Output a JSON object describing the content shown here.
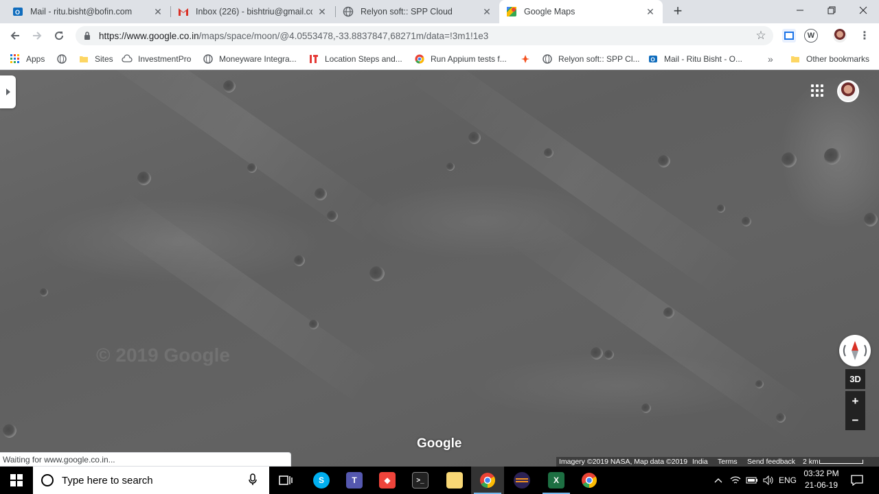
{
  "tabs": [
    {
      "title": "Mail - ritu.bisht@bofin.com",
      "icon": "outlook-icon"
    },
    {
      "title": "Inbox (226) - bishtriu@gmail.com",
      "icon": "gmail-icon"
    },
    {
      "title": "Relyon soft:: SPP Cloud",
      "icon": "globe-icon"
    },
    {
      "title": "Google Maps",
      "icon": "google-maps-icon",
      "active": true
    }
  ],
  "address_bar": {
    "host": "https://www.google.co.in",
    "path": "/maps/space/moon/@4.0553478,-33.8837847,68271m/data=!3m1!1e3"
  },
  "bookmarks": [
    {
      "label": "Apps",
      "icon": "apps-grid-icon"
    },
    {
      "label": "",
      "icon": "globe-icon"
    },
    {
      "label": "Sites",
      "icon": "folder-icon"
    },
    {
      "label": "InvestmentPro",
      "icon": "cloud-icon"
    },
    {
      "label": "Moneyware Integra...",
      "icon": "globe-icon"
    },
    {
      "label": "Location Steps and...",
      "icon": "it-icon"
    },
    {
      "label": "Run Appium tests f...",
      "icon": "chrome-icon"
    },
    {
      "label": "",
      "icon": "sparkle-icon"
    },
    {
      "label": "Relyon soft:: SPP Cl...",
      "icon": "globe-icon"
    },
    {
      "label": "Mail - Ritu Bisht - O...",
      "icon": "outlook-icon"
    }
  ],
  "bookmarks_overflow": "»",
  "other_bookmarks": "Other bookmarks",
  "map": {
    "watermark": "© 2019 Google",
    "logo": "Google",
    "view_mode": "3D",
    "zoom_in": "+",
    "zoom_out": "−",
    "attribution": {
      "imagery": "Imagery ©2019 NASA, Map data ©2019",
      "region": "India",
      "terms": "Terms",
      "feedback": "Send feedback",
      "scale": "2 km"
    }
  },
  "status": "Waiting for www.google.co.in...",
  "taskbar": {
    "search_placeholder": "Type here to search",
    "language": "ENG",
    "time": "03:32 PM",
    "date": "21-06-19"
  }
}
